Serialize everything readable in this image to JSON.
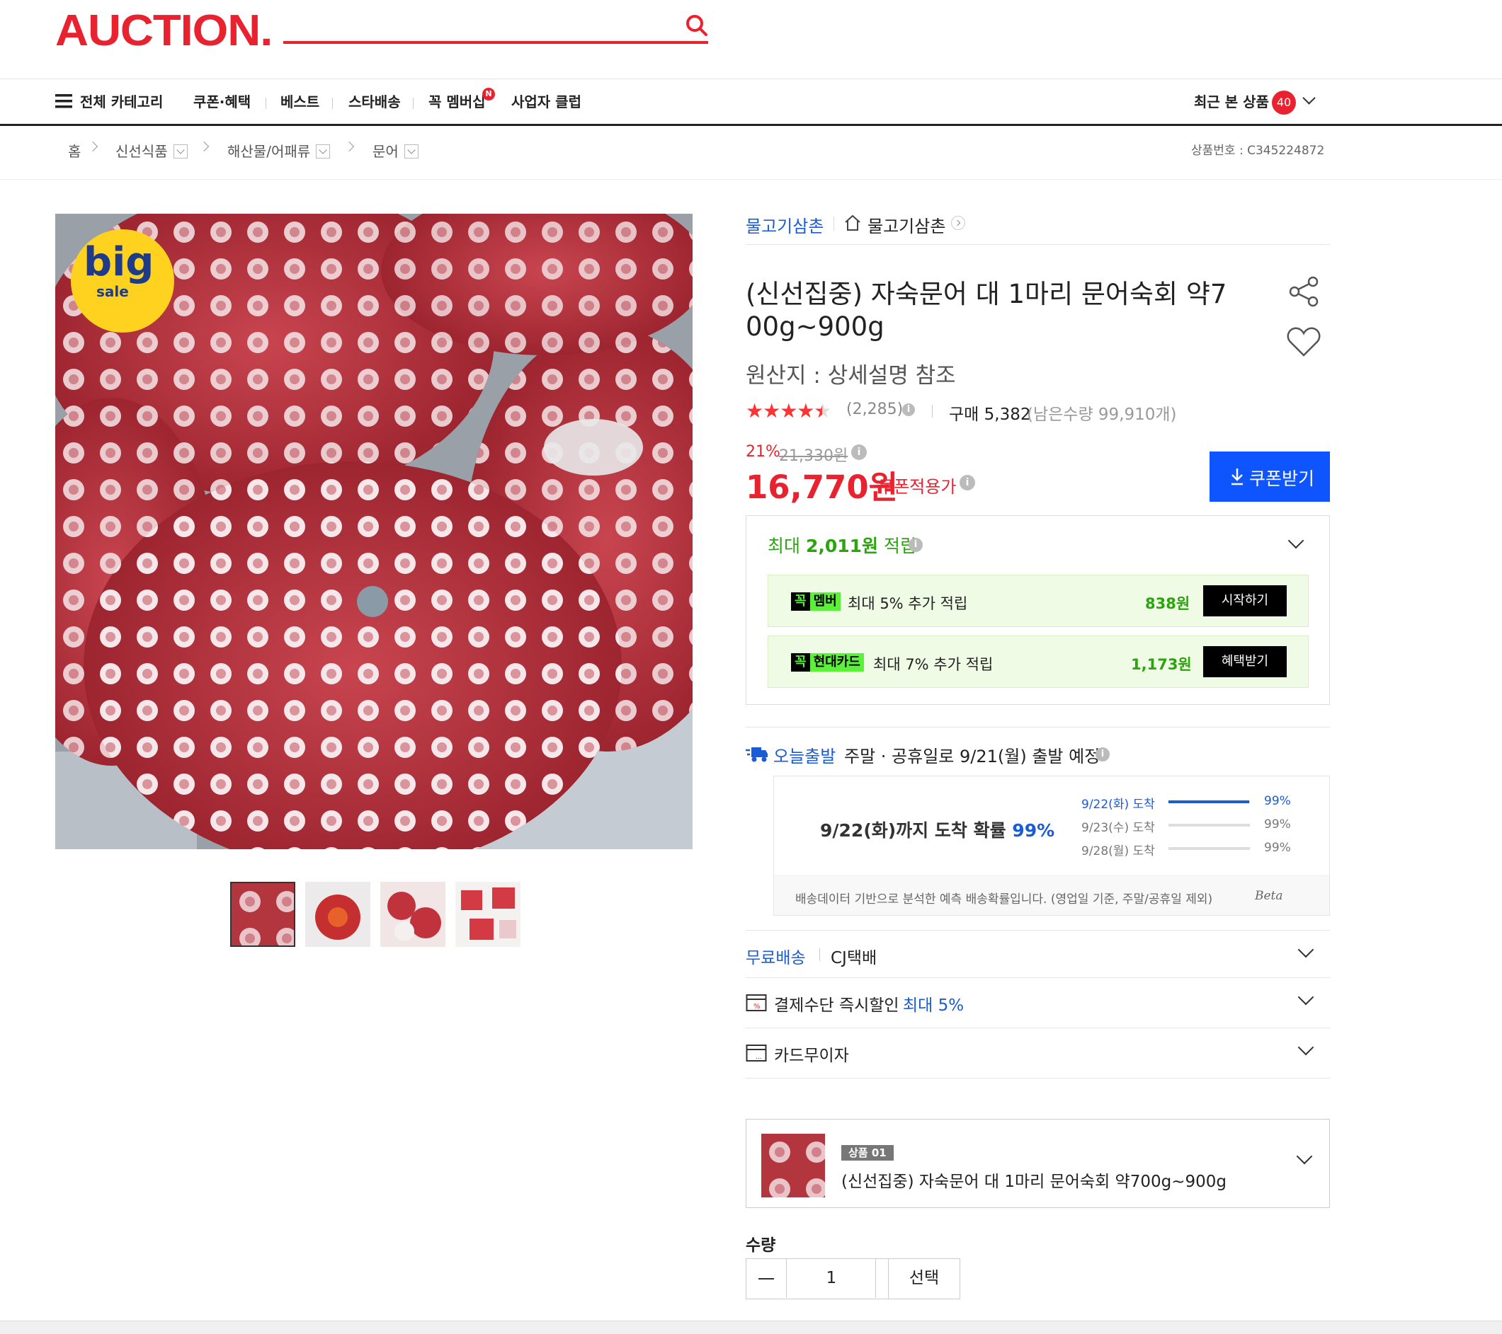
{
  "header": {
    "logo": "AUCTION."
  },
  "nav": {
    "all_categories": "전체 카테고리",
    "items": [
      "쿠폰·혜택",
      "베스트",
      "스타배송",
      "꼭 멤버십",
      "사업자 클럽"
    ],
    "membership_badge": "N",
    "recent_label": "최근 본 상품",
    "recent_count": "40"
  },
  "breadcrumb": {
    "home": "홈",
    "level1": "신선식품",
    "level2": "해산물/어패류",
    "level3": "문어",
    "product_no": "상품번호 : C345224872"
  },
  "main_image": {
    "badge_line1": "big",
    "badge_line2": "sale"
  },
  "seller": {
    "name": "물고기삼촌",
    "shop_name": "물고기삼촌"
  },
  "product": {
    "title_line1": "(신선집중) 자숙문어 대 1마리 문어숙회 약7",
    "title_line2": "00g~900g",
    "origin": "원산지 : 상세설명 참조",
    "rating_value": 4.5,
    "stars": "★★★★★",
    "review_count": "(2,285)",
    "purchase": "구매 5,382",
    "remaining": "(남은수량 99,910개)",
    "discount_rate": "21%",
    "original_price": "21,330원",
    "price": "16,770원",
    "coupon_price_label": "쿠폰적용가",
    "coupon_button": "쿠폰받기"
  },
  "points": {
    "max_prefix": "최대 ",
    "max_amount": "2,011원",
    "max_suffix": " 적립",
    "rows": [
      {
        "tag1": "꼭",
        "tag2": "멤버",
        "desc": "최대 5% 추가 적립",
        "amount": "838원",
        "button": "시작하기"
      },
      {
        "tag1": "꼭",
        "tag2": "현대카드",
        "desc": "최대 7% 추가 적립",
        "amount": "1,173원",
        "button": "혜택받기"
      }
    ]
  },
  "shipping": {
    "today_label": "오늘출발",
    "today_desc": "주말 · 공휴일로 9/21(월) 출발 예정",
    "arrival_main": "9/22(화)까지 도착 확률",
    "arrival_pct": "99%",
    "rows": [
      {
        "date": "9/22(화) 도착",
        "pct": "99%",
        "fill": 0.99
      },
      {
        "date": "9/23(수) 도착",
        "pct": "99%",
        "fill": 0
      },
      {
        "date": "9/28(월) 도착",
        "pct": "99%",
        "fill": 0
      }
    ],
    "note": "배송데이터 기반으로 분석한 예측 배송확률입니다. (영업일 기준, 주말/공휴일 제외)",
    "beta": "Beta"
  },
  "options": {
    "free_ship": "무료배송",
    "courier": "CJ택배",
    "payment_discount": "결제수단 즉시할인",
    "payment_max": "최대 5%",
    "card_interest": "카드무이자"
  },
  "selected": {
    "tag": "상품 01",
    "name": "(신선집중) 자숙문어 대 1마리 문어숙회 약700g~900g"
  },
  "quantity": {
    "label": "수량",
    "value": "1",
    "select": "선택"
  },
  "colors": {
    "brand": "#e8232f",
    "accent_blue": "#0e55ff",
    "link_blue": "#1a5bd6",
    "green": "#2ba40f"
  }
}
